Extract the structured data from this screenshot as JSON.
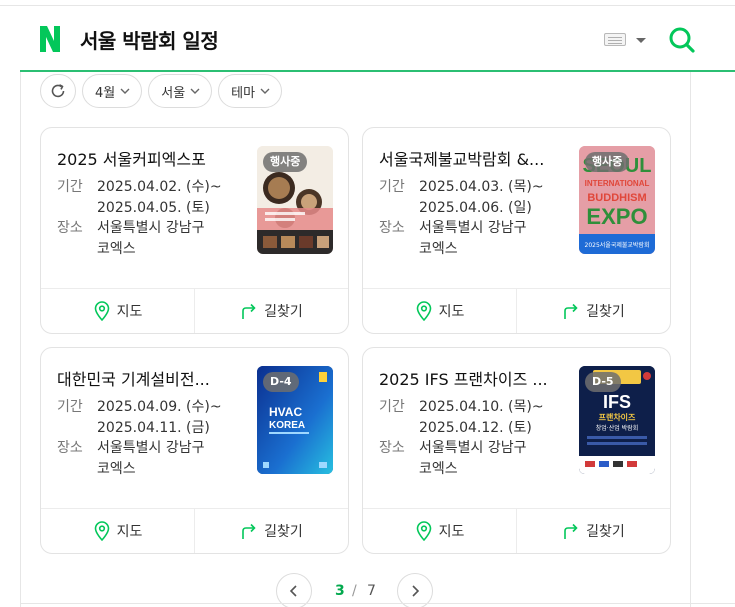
{
  "header": {
    "title": "서울 박람회 일정",
    "brand_color": "#03c75a",
    "logo_letter": "N"
  },
  "filters": [
    {
      "label": "4월"
    },
    {
      "label": "서울"
    },
    {
      "label": "테마"
    }
  ],
  "labels": {
    "period": "기간",
    "place": "장소",
    "map": "지도",
    "directions": "길찾기"
  },
  "events": [
    {
      "name": "2025 서울커피엑스포",
      "badge": "행사중",
      "period_start": "2025.04.02. (수)~",
      "period_end": "2025.04.05. (토)",
      "place_line1": "서울특별시 강남구",
      "place_line2": "코엑스"
    },
    {
      "name": "서울국제불교박람회 &...",
      "badge": "행사중",
      "period_start": "2025.04.03. (목)~",
      "period_end": "2025.04.06. (일)",
      "place_line1": "서울특별시 강남구",
      "place_line2": "코엑스",
      "poster_text": [
        "SEOUL",
        "INTERNATIONAL",
        "BUDDHISM",
        "EXPO",
        "2025서울국제불교박람회"
      ]
    },
    {
      "name": "대한민국 기계설비전...",
      "badge": "D-4",
      "period_start": "2025.04.09. (수)~",
      "period_end": "2025.04.11. (금)",
      "place_line1": "서울특별시 강남구",
      "place_line2": "코엑스",
      "poster_text": [
        "HVAC",
        "KOREA"
      ]
    },
    {
      "name": "2025 IFS 프랜차이즈 ...",
      "badge": "D-5",
      "period_start": "2025.04.10. (목)~",
      "period_end": "2025.04.12. (토)",
      "place_line1": "서울특별시 강남구",
      "place_line2": "코엑스",
      "poster_text": [
        "IFS",
        "프랜차이즈",
        "창업·산업 박람회"
      ]
    }
  ],
  "pagination": {
    "current": "3",
    "separator": "/",
    "total": "7"
  }
}
